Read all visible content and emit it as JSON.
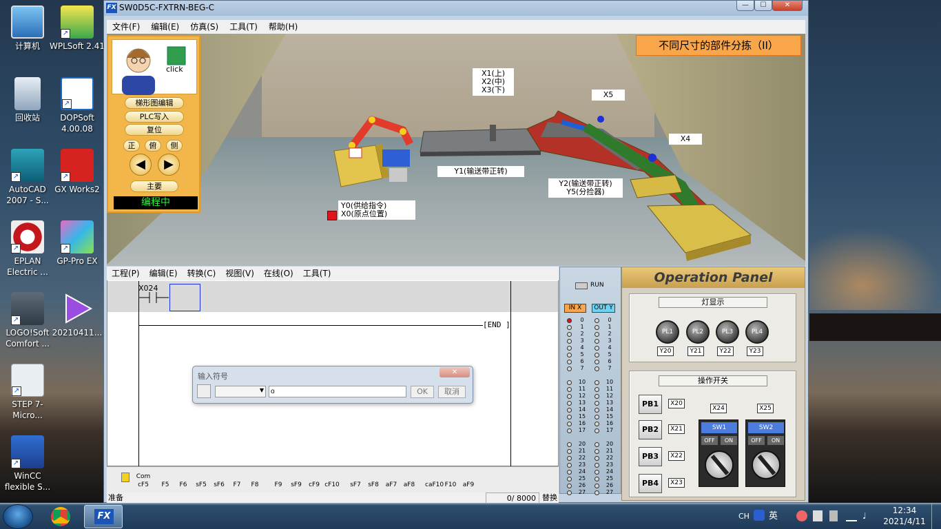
{
  "desktop": {
    "icons": [
      {
        "label": "计算机",
        "icon": "computer-icon"
      },
      {
        "label": "WPLSoft 2.41",
        "icon": "wplsoft-icon"
      },
      {
        "label": "回收站",
        "icon": "recycle-bin-icon"
      },
      {
        "label": "DOPSoft 4.00.08",
        "icon": "dopsoft-icon"
      },
      {
        "label": "AutoCAD 2007 - S...",
        "icon": "autocad-icon"
      },
      {
        "label": "GX Works2",
        "icon": "gx-works-icon"
      },
      {
        "label": "EPLAN Electric ...",
        "icon": "eplan-icon"
      },
      {
        "label": "GP-Pro EX",
        "icon": "gp-pro-icon"
      },
      {
        "label": "LOGO!Soft Comfort ...",
        "icon": "logo-soft-icon"
      },
      {
        "label": "20210411...",
        "icon": "mp4-video-icon"
      },
      {
        "label": "STEP 7-Micro...",
        "icon": "step7-icon"
      },
      {
        "label": "WinCC flexible S...",
        "icon": "wincc-icon"
      }
    ]
  },
  "window": {
    "title": "SW0D5C-FXTRN-BEG-C",
    "logo": "FX",
    "controls": [
      "minimize",
      "maximize",
      "close"
    ]
  },
  "menu": [
    "文件(F)",
    "编辑(E)",
    "仿真(S)",
    "工具(T)",
    "帮助(H)"
  ],
  "scene": {
    "title": "不同尺寸的部件分拣（II）",
    "labels": {
      "x1": "X1(上)",
      "x2": "X2(中)",
      "x3": "X3(下)",
      "x5": "X5",
      "x4": "X4",
      "y1": "Y1(输送带正转)",
      "y2": "Y2(输送带正转)",
      "y5": "Y5(分捡器)",
      "y0": "Y0(供给指令)",
      "x0": "X0(原点位置)"
    }
  },
  "control_panel": {
    "click_label": "click",
    "ladder_edit": "梯形图编辑",
    "plc_write": "PLC写入",
    "reset": "复位",
    "views": [
      "正",
      "俯",
      "侧"
    ],
    "main": "主要",
    "status": "编程中"
  },
  "ladder": {
    "menu": [
      "工程(P)",
      "编辑(E)",
      "转换(C)",
      "视图(V)",
      "在线(O)",
      "工具(T)"
    ],
    "contact": "X024",
    "end": "END"
  },
  "fkeys": [
    {
      "top": "",
      "bottom": ""
    },
    {
      "top": "Com",
      "bottom": "cF5"
    },
    {
      "top": "",
      "bottom": "F5"
    },
    {
      "top": "",
      "bottom": "F6"
    },
    {
      "top": "",
      "bottom": "sF5"
    },
    {
      "top": "",
      "bottom": "sF6"
    },
    {
      "top": "",
      "bottom": "F7"
    },
    {
      "top": "",
      "bottom": "F8"
    },
    {
      "top": "",
      "bottom": "F9"
    },
    {
      "top": "",
      "bottom": "sF9"
    },
    {
      "top": "",
      "bottom": "cF9"
    },
    {
      "top": "",
      "bottom": "cF10"
    },
    {
      "top": "",
      "bottom": "sF7"
    },
    {
      "top": "",
      "bottom": "sF8"
    },
    {
      "top": "",
      "bottom": "aF7"
    },
    {
      "top": "",
      "bottom": "aF8"
    },
    {
      "top": "",
      "bottom": "caF10"
    },
    {
      "top": "",
      "bottom": "F10"
    },
    {
      "top": "",
      "bottom": "aF9"
    }
  ],
  "status_bar": {
    "ready": "准备",
    "steps": "0/ 8000",
    "mode": "替换"
  },
  "io_monitor": {
    "run": "RUN",
    "in_header": "IN X",
    "out_header": "OUT Y",
    "numbers": [
      "0",
      "1",
      "2",
      "3",
      "4",
      "5",
      "6",
      "7",
      "10",
      "11",
      "12",
      "13",
      "14",
      "15",
      "16",
      "17",
      "20",
      "21",
      "22",
      "23",
      "24",
      "25",
      "26",
      "27"
    ]
  },
  "operation_panel": {
    "title": "Operation Panel",
    "lamps_header": "灯显示",
    "lamps": [
      {
        "name": "PL1",
        "addr": "Y20"
      },
      {
        "name": "PL2",
        "addr": "Y21"
      },
      {
        "name": "PL3",
        "addr": "Y22"
      },
      {
        "name": "PL4",
        "addr": "Y23"
      }
    ],
    "switches_header": "操作开关",
    "pushbuttons": [
      {
        "name": "PB1",
        "addr": "X20"
      },
      {
        "name": "PB2",
        "addr": "X21"
      },
      {
        "name": "PB3",
        "addr": "X22"
      },
      {
        "name": "PB4",
        "addr": "X23"
      }
    ],
    "selectors": [
      {
        "name": "SW1",
        "addr": "X24",
        "off": "OFF",
        "on": "ON"
      },
      {
        "name": "SW2",
        "addr": "X25",
        "off": "OFF",
        "on": "ON"
      }
    ]
  },
  "dialog": {
    "title": "输入符号",
    "input_value": "o",
    "ok": "OK",
    "cancel": "取消"
  },
  "taskbar": {
    "ime_lang": "CH",
    "ime_mode": "英",
    "time": "12:34",
    "date": "2021/4/11"
  }
}
